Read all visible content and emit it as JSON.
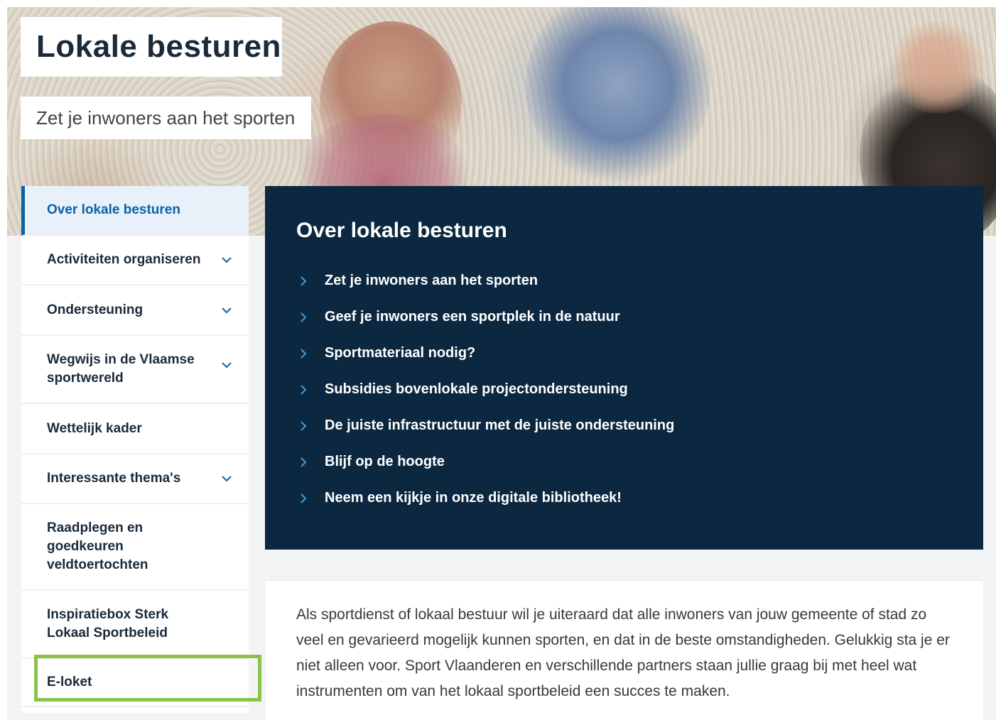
{
  "hero": {
    "title": "Lokale besturen",
    "subtitle": "Zet je inwoners aan het sporten"
  },
  "sidebar": {
    "items": [
      {
        "label": "Over lokale besturen",
        "active": true,
        "expandable": false
      },
      {
        "label": "Activiteiten organiseren",
        "active": false,
        "expandable": true
      },
      {
        "label": "Ondersteuning",
        "active": false,
        "expandable": true
      },
      {
        "label": "Wegwijs in de Vlaamse sportwereld",
        "active": false,
        "expandable": true
      },
      {
        "label": "Wettelijk kader",
        "active": false,
        "expandable": false
      },
      {
        "label": "Interessante thema's",
        "active": false,
        "expandable": true
      },
      {
        "label": "Raadplegen en goedkeuren veldtoertochten",
        "active": false,
        "expandable": false
      },
      {
        "label": "Inspiratiebox Sterk Lokaal Sportbeleid",
        "active": false,
        "expandable": false
      },
      {
        "label": "E-loket",
        "active": false,
        "expandable": false,
        "highlighted": true
      }
    ]
  },
  "nav_panel": {
    "heading": "Over lokale besturen",
    "links": [
      "Zet je inwoners aan het sporten",
      "Geef je inwoners een sportplek in de natuur",
      "Sportmateriaal nodig?",
      "Subsidies bovenlokale projectondersteuning",
      "De juiste infrastructuur met de juiste ondersteuning",
      "Blijf op de hoogte",
      "Neem een kijkje in onze digitale bibliotheek!"
    ]
  },
  "body": {
    "intro": "Als sportdienst of lokaal bestuur wil je uiteraard dat alle inwoners van jouw gemeente of stad zo veel en gevarieerd mogelijk kunnen sporten, en dat in de beste omstandigheden. Gelukkig sta je er niet alleen voor. Sport Vlaanderen en verschillende partners staan jullie graag bij met heel wat instrumenten om van het lokaal sportbeleid een succes te maken."
  },
  "colors": {
    "primary_dark": "#0c2841",
    "accent_blue": "#0b62a9",
    "highlight_green": "#8bc34a",
    "link_arrow": "#3d9be0"
  },
  "icons": {
    "chevron": "chevron-down-icon",
    "arrow": "chevron-right-icon"
  }
}
